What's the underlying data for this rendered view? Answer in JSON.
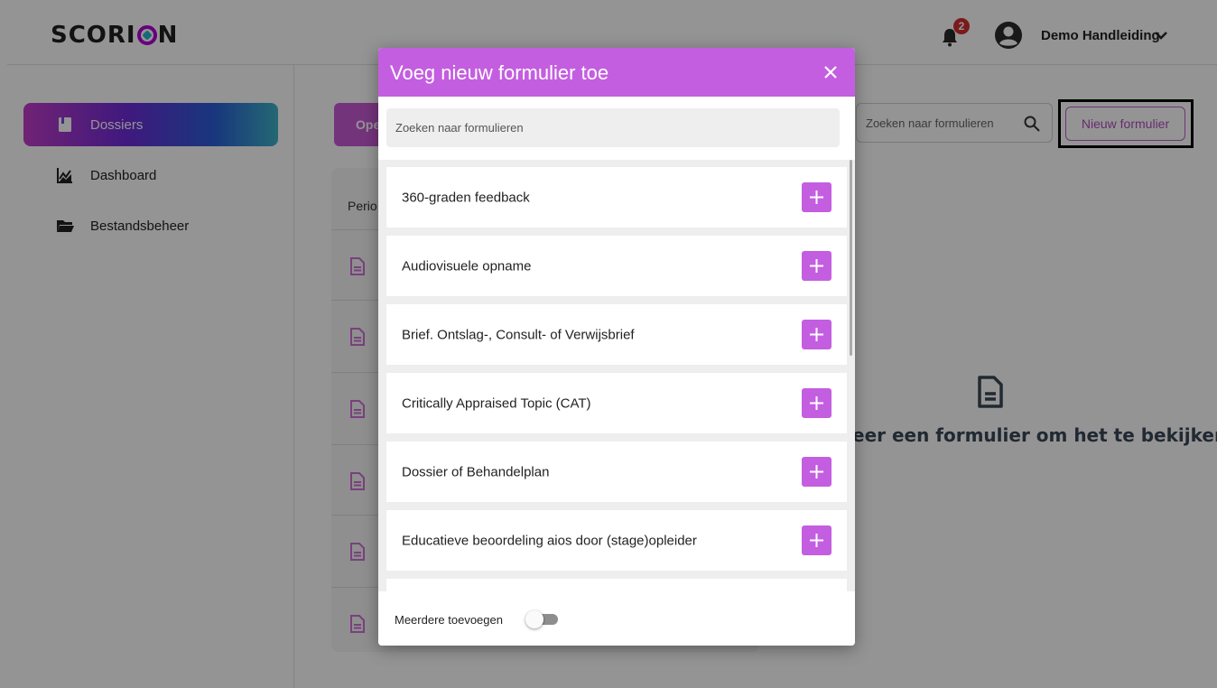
{
  "header": {
    "logo_text_1": "SCORI",
    "logo_text_2": "N",
    "notification_count": "2",
    "user_name": "Demo Handleiding"
  },
  "sidebar": {
    "items": [
      {
        "label": "Dossiers",
        "icon": "dossier-icon",
        "active": true
      },
      {
        "label": "Dashboard",
        "icon": "chart-icon",
        "active": false
      },
      {
        "label": "Bestandsbeheer",
        "icon": "folder-icon",
        "active": false
      }
    ]
  },
  "main": {
    "open_tab_label": "Ope",
    "list_header": "Perio",
    "search_placeholder": "Zoeken naar formulieren",
    "new_form_label": "Nieuw formulier",
    "empty_message": "eer een formulier om het te bekijken"
  },
  "modal": {
    "title": "Voeg nieuw formulier toe",
    "search_placeholder": "Zoeken naar formulieren",
    "forms": [
      "360-graden feedback",
      "Audiovisuele opname",
      "Brief. Ontslag-, Consult- of Verwijsbrief",
      "Critically Appraised Topic (CAT)",
      "Dossier of Behandelplan",
      "Educatieve beoordeling aios door (stage)opleider"
    ],
    "footer_label": "Meerdere toevoegen",
    "toggle_on": false
  },
  "colors": {
    "accent": "#c45ee0",
    "badge": "#d32f2f"
  }
}
